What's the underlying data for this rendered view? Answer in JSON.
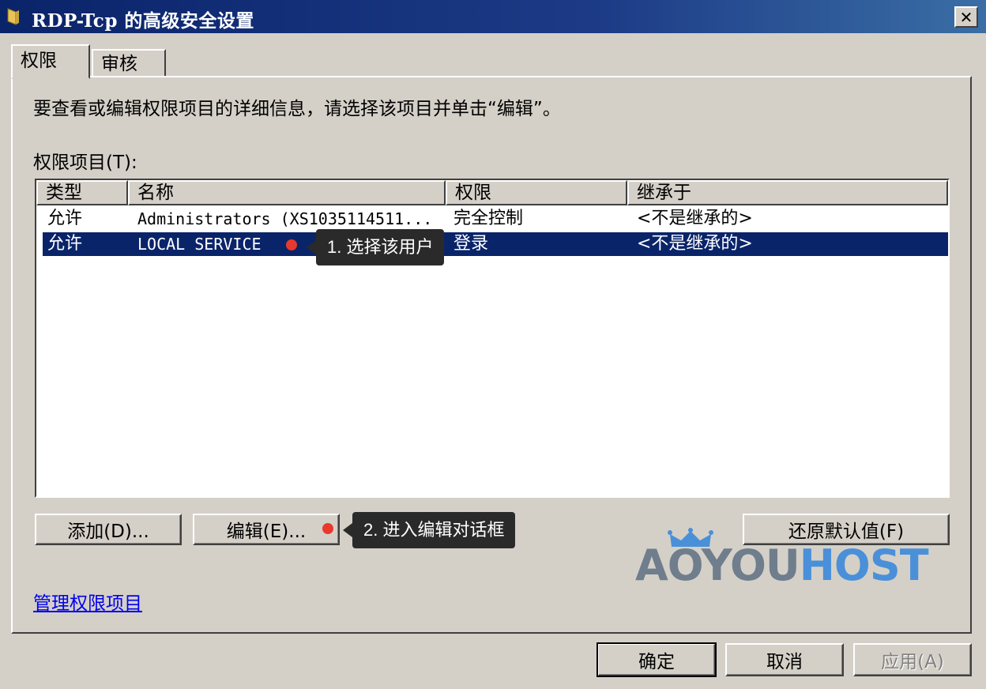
{
  "window": {
    "title": "RDP-Tcp 的高级安全设置",
    "close_label": "✕"
  },
  "tabs": [
    {
      "label": "权限",
      "active": true
    },
    {
      "label": "审核",
      "active": false
    }
  ],
  "instructions": "要查看或编辑权限项目的详细信息，请选择该项目并单击“编辑”。",
  "permission_entries_label": "权限项目(T):",
  "table": {
    "columns": [
      "类型",
      "名称",
      "权限",
      "继承于"
    ],
    "rows": [
      {
        "type": "允许",
        "name": "Administrators (XS1035114511...",
        "permission": "完全控制",
        "inherited": "<不是继承的>",
        "selected": false
      },
      {
        "type": "允许",
        "name": "LOCAL SERVICE",
        "permission": "登录",
        "inherited": "<不是继承的>",
        "selected": true
      }
    ]
  },
  "buttons": {
    "add": "添加(D)...",
    "edit": "编辑(E)...",
    "restore_defaults": "还原默认值(F)",
    "ok": "确定",
    "cancel": "取消",
    "apply": "应用(A)"
  },
  "manage_link": "管理权限项目",
  "annotations": {
    "step1": "1. 选择该用户",
    "step2": "2. 进入编辑对话框"
  },
  "watermark": {
    "part1": "AOYOU",
    "part2": "HOST"
  },
  "colors": {
    "title_bar": "#0a246a",
    "selection": "#0a246a",
    "annotation_dot": "#e8392c",
    "watermark_gray": "#6f7d8c",
    "watermark_blue": "#4a90d9"
  }
}
